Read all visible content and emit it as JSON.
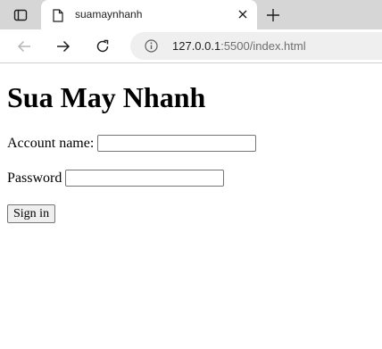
{
  "browser": {
    "tab": {
      "title": "suamaynhanh"
    },
    "address_bar": {
      "url_host": "127.0.0.1",
      "url_rest": ":5500/index.html"
    },
    "icons": {
      "tab_strip": "tab-strip-icon",
      "favicon": "document-icon",
      "close": "close-icon",
      "new_tab": "plus-icon",
      "back": "arrow-left-icon",
      "forward": "arrow-right-icon",
      "reload": "reload-icon",
      "site_info": "info-icon"
    }
  },
  "page": {
    "heading": "Sua May Nhanh",
    "form": {
      "account_label": "Account name:",
      "account_value": "",
      "password_label": "Password",
      "password_value": "",
      "submit_label": "Sign in"
    }
  }
}
